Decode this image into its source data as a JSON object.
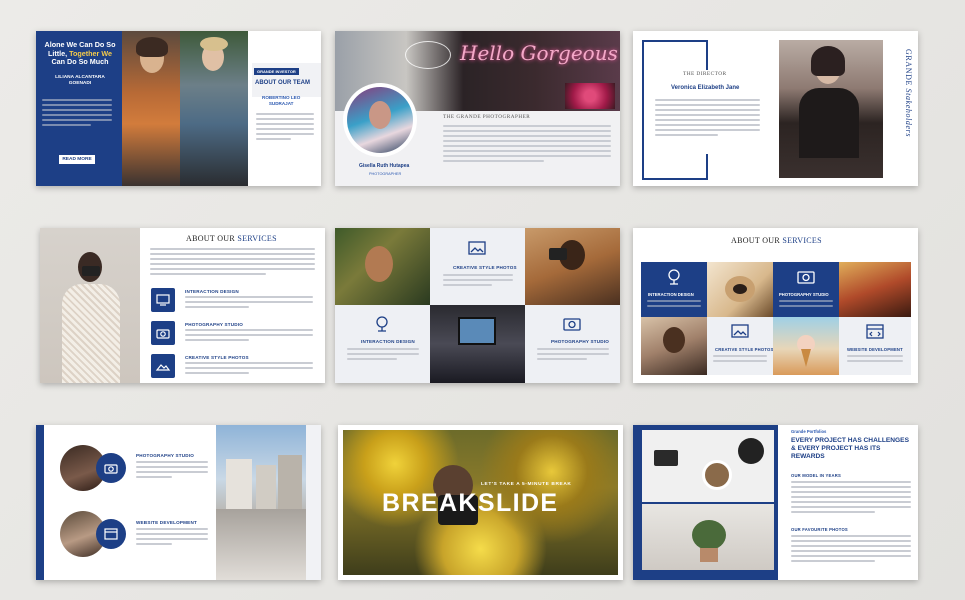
{
  "slides": {
    "team": {
      "headline_a": "Alone We Can Do So",
      "headline_b": "Little,",
      "headline_c": "Together We",
      "headline_d": "Can Do So Much",
      "author": "LILIANA ALCANTARA",
      "author2": "GOENADI",
      "read_more": "READ MORE",
      "tag": "GRANDE INVESTOR",
      "section_title": "ABOUT OUR TEAM",
      "member_name": "ROBERTINO LEO",
      "member_name2": "SUDRAJAT"
    },
    "photographer": {
      "neon_text": "Hello Gorgeous",
      "title": "THE GRANDE PHOTOGRAPHER",
      "name": "Gisella Ruth Hutapea",
      "role": "PHOTOGRAPHER"
    },
    "director": {
      "label": "THE DIRECTOR",
      "name": "Veronica Elizabeth Jane",
      "vertical_a": "GRANDE",
      "vertical_b": "Stakeholders"
    },
    "services_left": {
      "title_a": "ABOUT OUR",
      "title_b": "SERVICES",
      "items": [
        "INTERACTION DESIGN",
        "PHOTOGRAPHY STUDIO",
        "CREATIVE STYLE PHOTOS"
      ]
    },
    "grid_services": {
      "items": [
        "CREATIVE STYLE PHOTOS",
        "INTERACTION DESIGN",
        "PHOTOGRAPHY STUDIO"
      ]
    },
    "services_grid": {
      "title_a": "ABOUT OUR",
      "title_b": "SERVICES",
      "items": [
        "INTERACTION DESIGN",
        "PHOTOGRAPHY STUDIO",
        "CREATIVE STYLE PHOTOS",
        "WEBSITE DEVELOPMENT"
      ]
    },
    "studio": {
      "items": [
        "PHOTOGRAPHY STUDIO",
        "WEBSITE DEVELOPMENT"
      ]
    },
    "break": {
      "kicker": "LET'S TAKE A 5-MINUTE BREAK",
      "title": "BREAKSLIDE"
    },
    "portfolio": {
      "tag": "Grande Portfolios",
      "headline": "EVERY PROJECT HAS CHALLENGES & EVERY PROJECT HAS ITS REWARDS",
      "h1": "OUR MODEL IN YEARS",
      "h2": "OUR FAVOURITE PHOTOS"
    }
  },
  "colors": {
    "navy": "#1d3f86",
    "blue": "#2d5ab1"
  }
}
